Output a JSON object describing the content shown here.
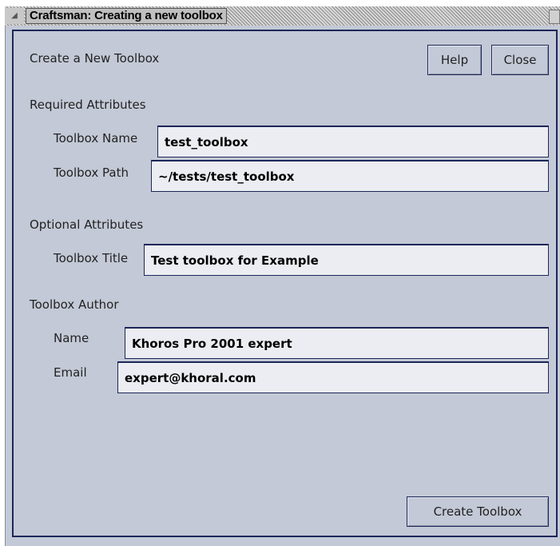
{
  "window": {
    "title": "Craftsman: Creating a new toolbox",
    "menu_glyph": "◢"
  },
  "header": {
    "heading": "Create a New Toolbox",
    "help_label": "Help",
    "close_label": "Close"
  },
  "required": {
    "section_label": "Required Attributes",
    "name_label": "Toolbox Name",
    "name_value": "test_toolbox",
    "path_label": "Toolbox Path",
    "path_value": "~/tests/test_toolbox"
  },
  "optional": {
    "section_label": "Optional Attributes",
    "title_label": "Toolbox Title",
    "title_value": "Test toolbox for Example"
  },
  "author": {
    "section_label": "Toolbox Author",
    "name_label": "Name",
    "name_value": "Khoros Pro 2001 expert",
    "email_label": "Email",
    "email_value": "expert@khoral.com"
  },
  "footer": {
    "create_label": "Create Toolbox"
  },
  "colors": {
    "background": "#c3c9d6",
    "border": "#1c2758",
    "field_bg": "#ecedf2"
  }
}
